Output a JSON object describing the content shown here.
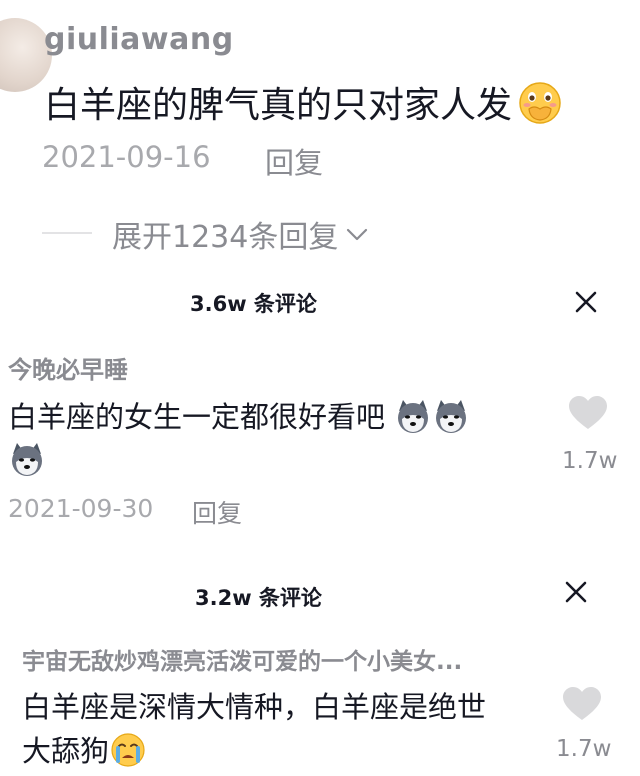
{
  "top_comment": {
    "username": "giuliawang",
    "text": "白羊座的脾气真的只对家人发",
    "emoji": "hand-over-mouth-emoji",
    "date": "2021-09-16",
    "reply_label": "回复",
    "expand_label": "展开1234条回复"
  },
  "sheet1": {
    "header": "3.6w 条评论",
    "comment": {
      "username": "今晚必早睡",
      "text_line1": "白羊座的女生一定都很好看吧",
      "emoji": "husky-emoji",
      "like_count": "1.7w",
      "date": "2021-09-30",
      "reply_label": "回复"
    }
  },
  "sheet2": {
    "header": "3.2w 条评论",
    "comment": {
      "username": "宇宙无敌炒鸡漂亮活泼可爱的一个小美女...",
      "text_line1": "白羊座是深情大情种，白羊座是绝世",
      "text_line2": "大舔狗",
      "emoji": "crying-emoji",
      "like_count": "1.7w"
    }
  },
  "colors": {
    "primary_text": "#161823",
    "secondary_text": "#8a8b91",
    "tertiary_text": "#a8a9ad",
    "heart": "#d9d9db"
  }
}
